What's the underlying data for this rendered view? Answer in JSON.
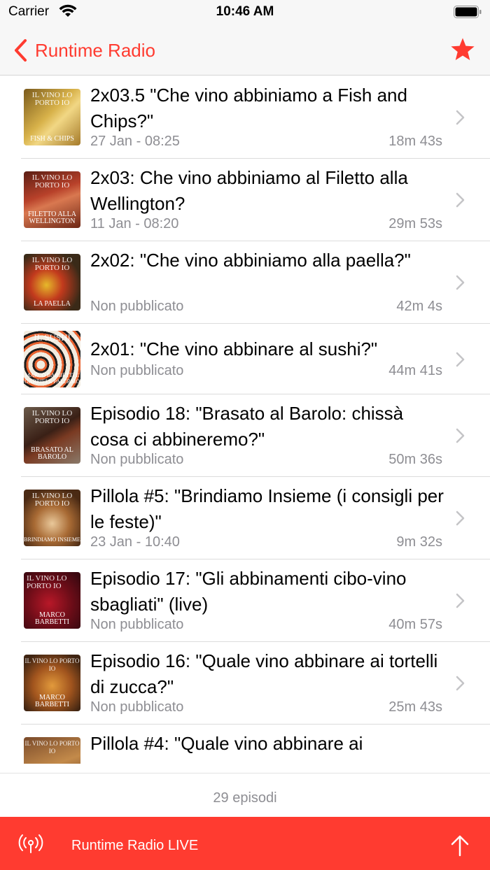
{
  "status_bar": {
    "carrier": "Carrier",
    "time": "10:46 AM"
  },
  "nav": {
    "back_label": "Runtime Radio",
    "accent_color": "#ff3b30"
  },
  "episodes": [
    {
      "title": "2x03.5 \"Che vino abbiniamo a Fish and Chips?\"",
      "date": "27 Jan - 08:25",
      "duration": "18m 43s",
      "thumb_title": "IL VINO LO PORTO IO",
      "thumb_caption": "FISH & CHIPS"
    },
    {
      "title": "2x03: Che vino abbiniamo al Filetto alla Wellington?",
      "date": "11 Jan - 08:20",
      "duration": "29m 53s",
      "thumb_title": "IL VINO LO PORTO IO",
      "thumb_caption": "FILETTO ALLA WELLINGTON"
    },
    {
      "title": "2x02: \"Che vino abbiniamo alla paella?\"",
      "date": "Non pubblicato",
      "duration": "42m 4s",
      "thumb_title": "IL VINO LO PORTO IO",
      "thumb_caption": "LA PAELLA"
    },
    {
      "title": "2x01: \"Che vino abbinare al sushi?\"",
      "date": "Non pubblicato",
      "duration": "44m 41s",
      "thumb_title": "IL SUSHI",
      "thumb_caption": "MARCO BARBETTI E GABRIELE PALERMO"
    },
    {
      "title": "Episodio 18: \"Brasato al Barolo: chissà cosa ci abbineremo?\"",
      "date": "Non pubblicato",
      "duration": "50m 36s",
      "thumb_title": "IL VINO LO PORTO IO",
      "thumb_caption": "BRASATO AL BAROLO"
    },
    {
      "title": "Pillola #5: \"Brindiamo Insieme (i consigli per le feste)\"",
      "date": "23 Jan - 10:40",
      "duration": "9m 32s",
      "thumb_title": "IL VINO LO PORTO IO",
      "thumb_caption": "BRINDIAMO INSIEME"
    },
    {
      "title": "Episodio 17: \"Gli abbinamenti cibo-vino sbagliati\" (live)",
      "date": "Non pubblicato",
      "duration": "40m 57s",
      "thumb_title": "IL VINO LO PORTO IO",
      "thumb_caption": "MARCO BARBETTI"
    },
    {
      "title": "Episodio 16: \"Quale vino abbinare ai tortelli di zucca?\"",
      "date": "Non pubblicato",
      "duration": "25m 43s",
      "thumb_title": "IL VINO LO PORTO IO",
      "thumb_caption": "MARCO BARBETTI"
    },
    {
      "title": "Pillola #4: \"Quale vino abbinare ai",
      "date": "",
      "duration": "",
      "thumb_title": "IL VINO LO PORTO IO",
      "thumb_caption": ""
    }
  ],
  "footer": {
    "count_label": "29 episodi"
  },
  "live_bar": {
    "label": "Runtime Radio LIVE"
  }
}
